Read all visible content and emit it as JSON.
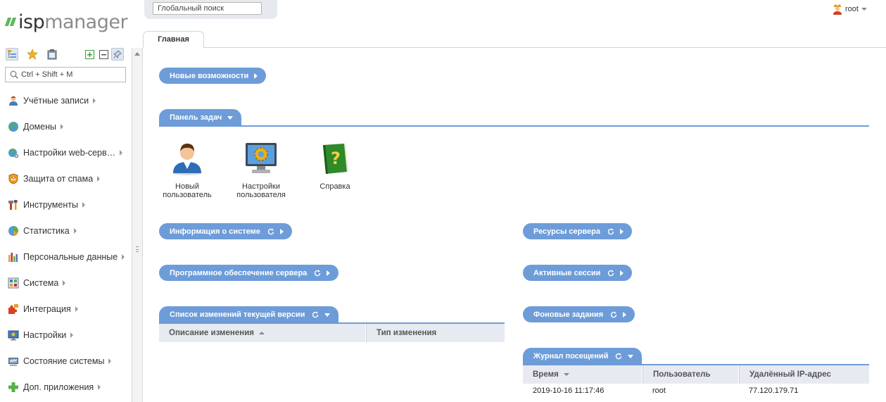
{
  "app": {
    "logo_part1": "isp",
    "logo_part2": "manager"
  },
  "sidebar": {
    "search_placeholder": "Ctrl + Shift + M",
    "tools": [
      "tree-view",
      "favorites",
      "clipboard",
      "expand-all",
      "collapse-all",
      "pin"
    ],
    "items": [
      {
        "label": "Учётные записи",
        "icon": "user-accounts-icon"
      },
      {
        "label": "Домены",
        "icon": "globe-icon"
      },
      {
        "label": "Настройки web-серв…",
        "icon": "web-settings-icon"
      },
      {
        "label": "Защита от спама",
        "icon": "spam-shield-icon"
      },
      {
        "label": "Инструменты",
        "icon": "tools-icon"
      },
      {
        "label": "Статистика",
        "icon": "pie-chart-icon"
      },
      {
        "label": "Персональные данные",
        "icon": "bar-chart-icon"
      },
      {
        "label": "Система",
        "icon": "system-icon"
      },
      {
        "label": "Интеграция",
        "icon": "puzzle-icon"
      },
      {
        "label": "Настройки",
        "icon": "settings-monitor-icon"
      },
      {
        "label": "Состояние системы",
        "icon": "server-status-icon"
      },
      {
        "label": "Доп. приложения",
        "icon": "plus-icon"
      }
    ]
  },
  "header": {
    "global_search_placeholder": "Глобальный поиск",
    "user": "root",
    "tab": "Главная"
  },
  "widgets": {
    "whats_new": "Новые возможности",
    "taskbar": "Панель задач",
    "system_info": "Информация о системе",
    "server_resources": "Ресурсы сервера",
    "server_software": "Программное обеспечение сервера",
    "active_sessions": "Активные сессии",
    "changelog": "Список изменений текущей версии",
    "background_tasks": "Фоновые задания",
    "visit_log": "Журнал посещений"
  },
  "tasks": [
    {
      "line1": "Новый",
      "line2": "пользователь",
      "icon": "new-user-icon"
    },
    {
      "line1": "Настройки",
      "line2": "пользователя",
      "icon": "user-settings-icon"
    },
    {
      "line1": "Справка",
      "line2": "",
      "icon": "help-book-icon"
    }
  ],
  "changelog_table": {
    "columns": [
      "Описание изменения",
      "Тип изменения"
    ]
  },
  "visit_table": {
    "columns": [
      "Время",
      "Пользователь",
      "Удалённый IP-адрес"
    ],
    "rows": [
      [
        "2019-10-16 11:17:46",
        "root",
        "77.120.179.71"
      ]
    ]
  },
  "colors": {
    "accent": "#6d9cd9",
    "logo_green": "#5cb85c",
    "table_header": "#e7ebf1"
  }
}
